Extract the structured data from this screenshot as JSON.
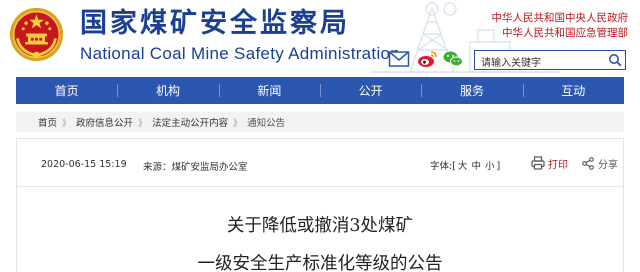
{
  "header": {
    "site_name_cn": "国家煤矿安全监察局",
    "site_name_en": "National Coal Mine Safety Administration",
    "links": [
      "中华人民共和国中央人民政府",
      "中华人民共和国应急管理部"
    ],
    "social_icons": [
      "email-icon",
      "weibo-icon",
      "wechat-icon"
    ],
    "search": {
      "placeholder": "请输入关键字",
      "button_icon": "search-icon"
    },
    "colors": {
      "brand_blue": "#1a3f93",
      "link_red": "#c0141b"
    }
  },
  "nav": {
    "items": [
      "首页",
      "机构",
      "新闻",
      "公开",
      "服务",
      "互动"
    ],
    "background": "#2c57b0"
  },
  "breadcrumb": {
    "items": [
      "首页",
      "政府信息公开",
      "法定主动公开内容"
    ],
    "current": "通知公告",
    "separator": "》"
  },
  "article": {
    "date": "2020-06-15 15:19",
    "source": "来源：煤矿安监局办公室",
    "font_label": "字体:",
    "font_open": "[",
    "font_sizes": [
      "大",
      "中",
      "小"
    ],
    "font_close": "]",
    "print_label": "打印",
    "share_label": "分享",
    "title_line1": "关于降低或撤消3处煤矿",
    "title_line2": "一级安全生产标准化等级的公告"
  }
}
